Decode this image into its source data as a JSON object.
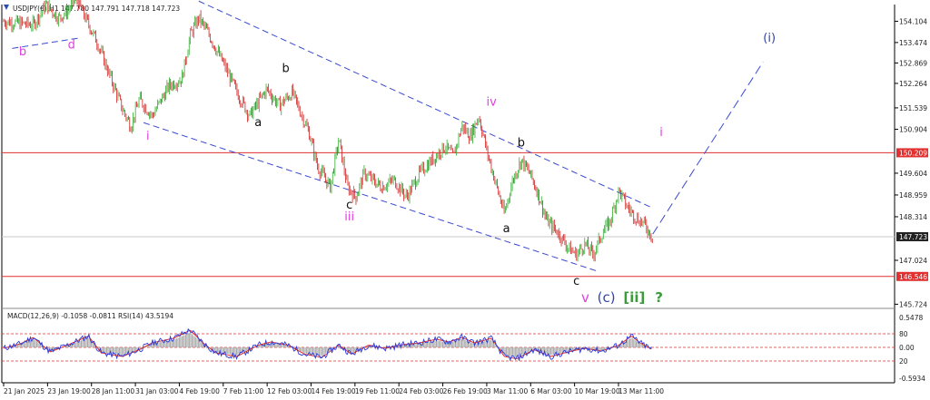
{
  "header": {
    "main": "USDJPY(€),H1  147.780 147.791 147.718 147.723",
    "indicator": "MACD(12,26,9) -0.1058 -0.0811 RSI(14) 43.5194"
  },
  "chart_data": {
    "type": "candlestick",
    "symbol": "USDJPY(€)",
    "timeframe": "H1",
    "ohlc": {
      "open": 147.78,
      "high": 147.791,
      "low": 147.718,
      "close": 147.723
    },
    "y_ticks": [
      "154.104",
      "153.474",
      "152.869",
      "152.264",
      "151.539",
      "150.904",
      "150.209",
      "149.604",
      "148.959",
      "148.314",
      "147.723",
      "147.024",
      "146.546",
      "145.724"
    ],
    "x_ticks": [
      "21 Jan 2025",
      "23 Jan 19:00",
      "28 Jan 11:00",
      "31 Jan 03:00",
      "4 Feb 19:00",
      "7 Feb 11:00",
      "12 Feb 03:00",
      "14 Feb 19:00",
      "19 Feb 11:00",
      "24 Feb 03:00",
      "26 Feb 19:00",
      "3 Mar 11:00",
      "6 Mar 03:00",
      "10 Mar 19:00",
      "13 Mar 11:00"
    ],
    "horizontal_levels": [
      {
        "value": 150.209,
        "label": "150.209"
      },
      {
        "value": 146.546,
        "label": "146.546"
      }
    ],
    "current_price": "147.723",
    "price_path": [
      {
        "t": 0,
        "p": 154.1
      },
      {
        "t": 14,
        "p": 154.0
      },
      {
        "t": 20,
        "p": 154.6
      },
      {
        "t": 26,
        "p": 154.2
      },
      {
        "t": 30,
        "p": 154.4
      },
      {
        "t": 34,
        "p": 154.8
      },
      {
        "t": 44,
        "p": 153.5
      },
      {
        "t": 50,
        "p": 152.5
      },
      {
        "t": 56,
        "p": 151.5
      },
      {
        "t": 60,
        "p": 151.0
      },
      {
        "t": 64,
        "p": 151.8
      },
      {
        "t": 70,
        "p": 151.3
      },
      {
        "t": 78,
        "p": 152.2
      },
      {
        "t": 84,
        "p": 152.4
      },
      {
        "t": 88,
        "p": 153.7
      },
      {
        "t": 92,
        "p": 154.2
      },
      {
        "t": 96,
        "p": 153.8
      },
      {
        "t": 104,
        "p": 152.8
      },
      {
        "t": 110,
        "p": 152.0
      },
      {
        "t": 116,
        "p": 151.3
      },
      {
        "t": 124,
        "p": 152.1
      },
      {
        "t": 130,
        "p": 151.6
      },
      {
        "t": 136,
        "p": 152.0
      },
      {
        "t": 144,
        "p": 150.8
      },
      {
        "t": 148,
        "p": 149.8
      },
      {
        "t": 154,
        "p": 149.2
      },
      {
        "t": 158,
        "p": 150.6
      },
      {
        "t": 162,
        "p": 149.2
      },
      {
        "t": 166,
        "p": 148.9
      },
      {
        "t": 170,
        "p": 149.6
      },
      {
        "t": 178,
        "p": 149.2
      },
      {
        "t": 184,
        "p": 149.4
      },
      {
        "t": 190,
        "p": 148.9
      },
      {
        "t": 196,
        "p": 149.6
      },
      {
        "t": 202,
        "p": 150.0
      },
      {
        "t": 208,
        "p": 150.4
      },
      {
        "t": 212,
        "p": 150.1
      },
      {
        "t": 216,
        "p": 151.0
      },
      {
        "t": 220,
        "p": 150.7
      },
      {
        "t": 224,
        "p": 151.3
      },
      {
        "t": 228,
        "p": 150.2
      },
      {
        "t": 232,
        "p": 149.3
      },
      {
        "t": 236,
        "p": 148.4
      },
      {
        "t": 240,
        "p": 149.4
      },
      {
        "t": 244,
        "p": 150.0
      },
      {
        "t": 248,
        "p": 149.6
      },
      {
        "t": 252,
        "p": 149.0
      },
      {
        "t": 256,
        "p": 148.2
      },
      {
        "t": 262,
        "p": 147.8
      },
      {
        "t": 266,
        "p": 147.4
      },
      {
        "t": 270,
        "p": 147.2
      },
      {
        "t": 274,
        "p": 147.5
      },
      {
        "t": 278,
        "p": 147.2
      },
      {
        "t": 282,
        "p": 147.8
      },
      {
        "t": 286,
        "p": 148.2
      },
      {
        "t": 290,
        "p": 149.1
      },
      {
        "t": 294,
        "p": 148.6
      },
      {
        "t": 298,
        "p": 148.3
      },
      {
        "t": 302,
        "p": 148.1
      },
      {
        "t": 306,
        "p": 147.7
      }
    ],
    "channel": [
      {
        "from": {
          "t": 92,
          "p": 154.7
        },
        "to": {
          "t": 305,
          "p": 148.6
        }
      },
      {
        "from": {
          "t": 66,
          "p": 151.1
        },
        "to": {
          "t": 280,
          "p": 146.7
        }
      },
      {
        "from": {
          "t": 4,
          "p": 153.3
        },
        "to": {
          "t": 35,
          "p": 153.6
        }
      }
    ],
    "projection": {
      "from": {
        "t": 306,
        "p": 147.8
      },
      "to": {
        "t": 358,
        "p": 152.9
      }
    },
    "wave_labels": [
      {
        "text": "b",
        "t": 9,
        "p": 153.1,
        "color": "pink"
      },
      {
        "text": "d",
        "t": 32,
        "p": 153.3,
        "color": "pink"
      },
      {
        "text": "i",
        "t": 68,
        "p": 150.6,
        "color": "pink"
      },
      {
        "text": "a",
        "t": 120,
        "p": 151.0,
        "color": "black"
      },
      {
        "text": "b",
        "t": 133,
        "p": 152.6,
        "color": "black"
      },
      {
        "text": "c",
        "t": 163,
        "p": 148.55,
        "color": "black"
      },
      {
        "text": "iii",
        "t": 163,
        "p": 148.2,
        "color": "pink"
      },
      {
        "text": "iv",
        "t": 230,
        "p": 151.6,
        "color": "pink"
      },
      {
        "text": "b",
        "t": 244,
        "p": 150.4,
        "color": "black"
      },
      {
        "text": "a",
        "t": 237,
        "p": 147.85,
        "color": "black"
      },
      {
        "text": "c",
        "t": 270,
        "p": 146.3,
        "color": "black"
      },
      {
        "text": "i",
        "t": 310,
        "p": 150.7,
        "color": "pink"
      },
      {
        "text": "(i)",
        "t": 361,
        "p": 153.5,
        "color": "navy"
      }
    ],
    "bottom_label": [
      {
        "text": "v",
        "color": "pink"
      },
      {
        "text": "(c)",
        "color": "navy"
      },
      {
        "text": "[ii]",
        "color": "green"
      },
      {
        "text": "?",
        "color": "green"
      }
    ],
    "subwindow": {
      "right_ticks": [
        "0.5478",
        "80",
        "0.00",
        "20",
        "-0.5934"
      ],
      "levels": [
        80,
        50,
        20
      ],
      "rsi": [
        {
          "t": 0,
          "v": 48
        },
        {
          "t": 8,
          "v": 58
        },
        {
          "t": 14,
          "v": 72
        },
        {
          "t": 22,
          "v": 40
        },
        {
          "t": 30,
          "v": 55
        },
        {
          "t": 40,
          "v": 75
        },
        {
          "t": 46,
          "v": 38
        },
        {
          "t": 56,
          "v": 30
        },
        {
          "t": 64,
          "v": 45
        },
        {
          "t": 70,
          "v": 60
        },
        {
          "t": 80,
          "v": 70
        },
        {
          "t": 88,
          "v": 88
        },
        {
          "t": 94,
          "v": 60
        },
        {
          "t": 100,
          "v": 38
        },
        {
          "t": 110,
          "v": 30
        },
        {
          "t": 120,
          "v": 55
        },
        {
          "t": 126,
          "v": 62
        },
        {
          "t": 134,
          "v": 55
        },
        {
          "t": 142,
          "v": 35
        },
        {
          "t": 150,
          "v": 28
        },
        {
          "t": 158,
          "v": 55
        },
        {
          "t": 164,
          "v": 35
        },
        {
          "t": 172,
          "v": 55
        },
        {
          "t": 180,
          "v": 48
        },
        {
          "t": 188,
          "v": 56
        },
        {
          "t": 196,
          "v": 60
        },
        {
          "t": 204,
          "v": 68
        },
        {
          "t": 210,
          "v": 62
        },
        {
          "t": 216,
          "v": 72
        },
        {
          "t": 222,
          "v": 60
        },
        {
          "t": 230,
          "v": 70
        },
        {
          "t": 236,
          "v": 30
        },
        {
          "t": 242,
          "v": 25
        },
        {
          "t": 250,
          "v": 45
        },
        {
          "t": 258,
          "v": 30
        },
        {
          "t": 266,
          "v": 40
        },
        {
          "t": 274,
          "v": 48
        },
        {
          "t": 282,
          "v": 42
        },
        {
          "t": 290,
          "v": 55
        },
        {
          "t": 296,
          "v": 75
        },
        {
          "t": 300,
          "v": 60
        },
        {
          "t": 306,
          "v": 45
        }
      ]
    }
  }
}
